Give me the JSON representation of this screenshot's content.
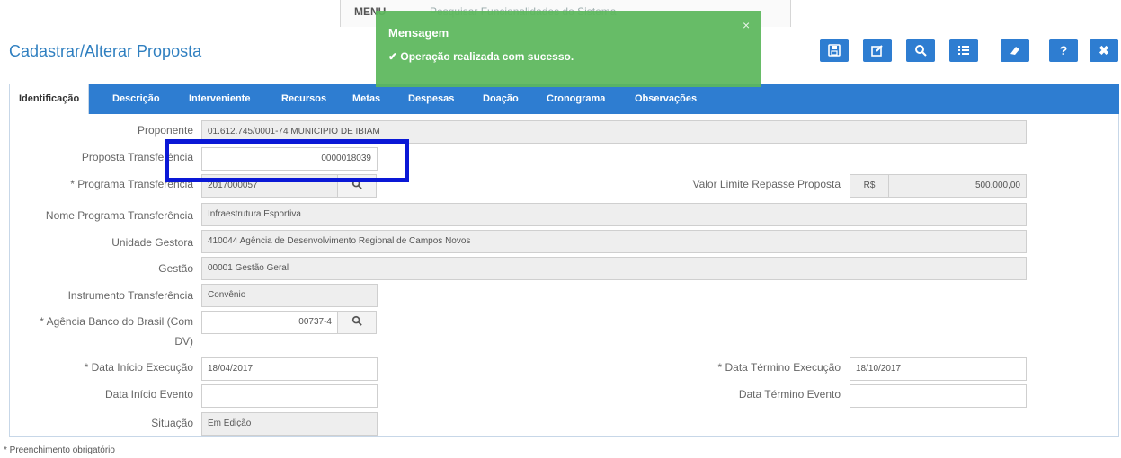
{
  "topbar": {
    "menu_label": "MENU",
    "search_text": "Pesquisar Funcionalidades do Sistema"
  },
  "header": {
    "title": "Cadastrar/Alterar Proposta"
  },
  "toolbar": {
    "buttons": [
      {
        "name": "save-button",
        "icon": "save-icon"
      },
      {
        "name": "edit-button",
        "icon": "edit-icon"
      },
      {
        "name": "search-button",
        "icon": "search-icon"
      },
      {
        "name": "list-button",
        "icon": "list-icon"
      },
      {
        "name": "clear-button",
        "icon": "eraser-icon"
      },
      {
        "name": "help-button",
        "icon": "help-icon",
        "label": "?"
      },
      {
        "name": "close-button",
        "icon": "close-icon",
        "label": "✖"
      }
    ],
    "accent": "#2e7dd1"
  },
  "toast": {
    "title": "Mensagem",
    "message": "✔ Operação realizada com sucesso.",
    "close": "×",
    "color": "#5cb85c"
  },
  "tabs": [
    "Identificação",
    "Descrição",
    "Interveniente",
    "Recursos",
    "Metas",
    "Despesas",
    "Doação",
    "Cronograma",
    "Observações"
  ],
  "form": {
    "proponente": {
      "label": "Proponente",
      "value": "01.612.745/0001-74 MUNICIPIO DE IBIAM"
    },
    "proposta": {
      "label": "Proposta Transferência",
      "value": "0000018039"
    },
    "programa": {
      "label": "* Programa Transferência",
      "value": "2017000057"
    },
    "valor_limite": {
      "label": "Valor Limite Repasse Proposta",
      "currency": "R$",
      "value": "500.000,00"
    },
    "nome_programa": {
      "label": "Nome Programa Transferência",
      "value": "Infraestrutura Esportiva"
    },
    "unidade_gestora": {
      "label": "Unidade Gestora",
      "value": "410044 Agência de Desenvolvimento Regional de Campos Novos"
    },
    "gestao": {
      "label": "Gestão",
      "value": "00001 Gestão Geral"
    },
    "instrumento": {
      "label": "Instrumento Transferência",
      "value": "Convênio"
    },
    "agencia": {
      "label_line1": "* Agência Banco do Brasil (Com",
      "label_line2": "DV)",
      "value": "00737-4"
    },
    "data_inicio_exec": {
      "label": "* Data Início Execução",
      "value": "18/04/2017"
    },
    "data_termino_exec": {
      "label": "* Data Término Execução",
      "value": "18/10/2017"
    },
    "data_inicio_evento": {
      "label": "Data Início Evento",
      "value": ""
    },
    "data_termino_evento": {
      "label": "Data Término Evento",
      "value": ""
    },
    "situacao": {
      "label": "Situação",
      "value": "Em Edição"
    }
  },
  "footer": {
    "note": "* Preenchimento obrigatório"
  },
  "highlight_color": "#0a18d6"
}
